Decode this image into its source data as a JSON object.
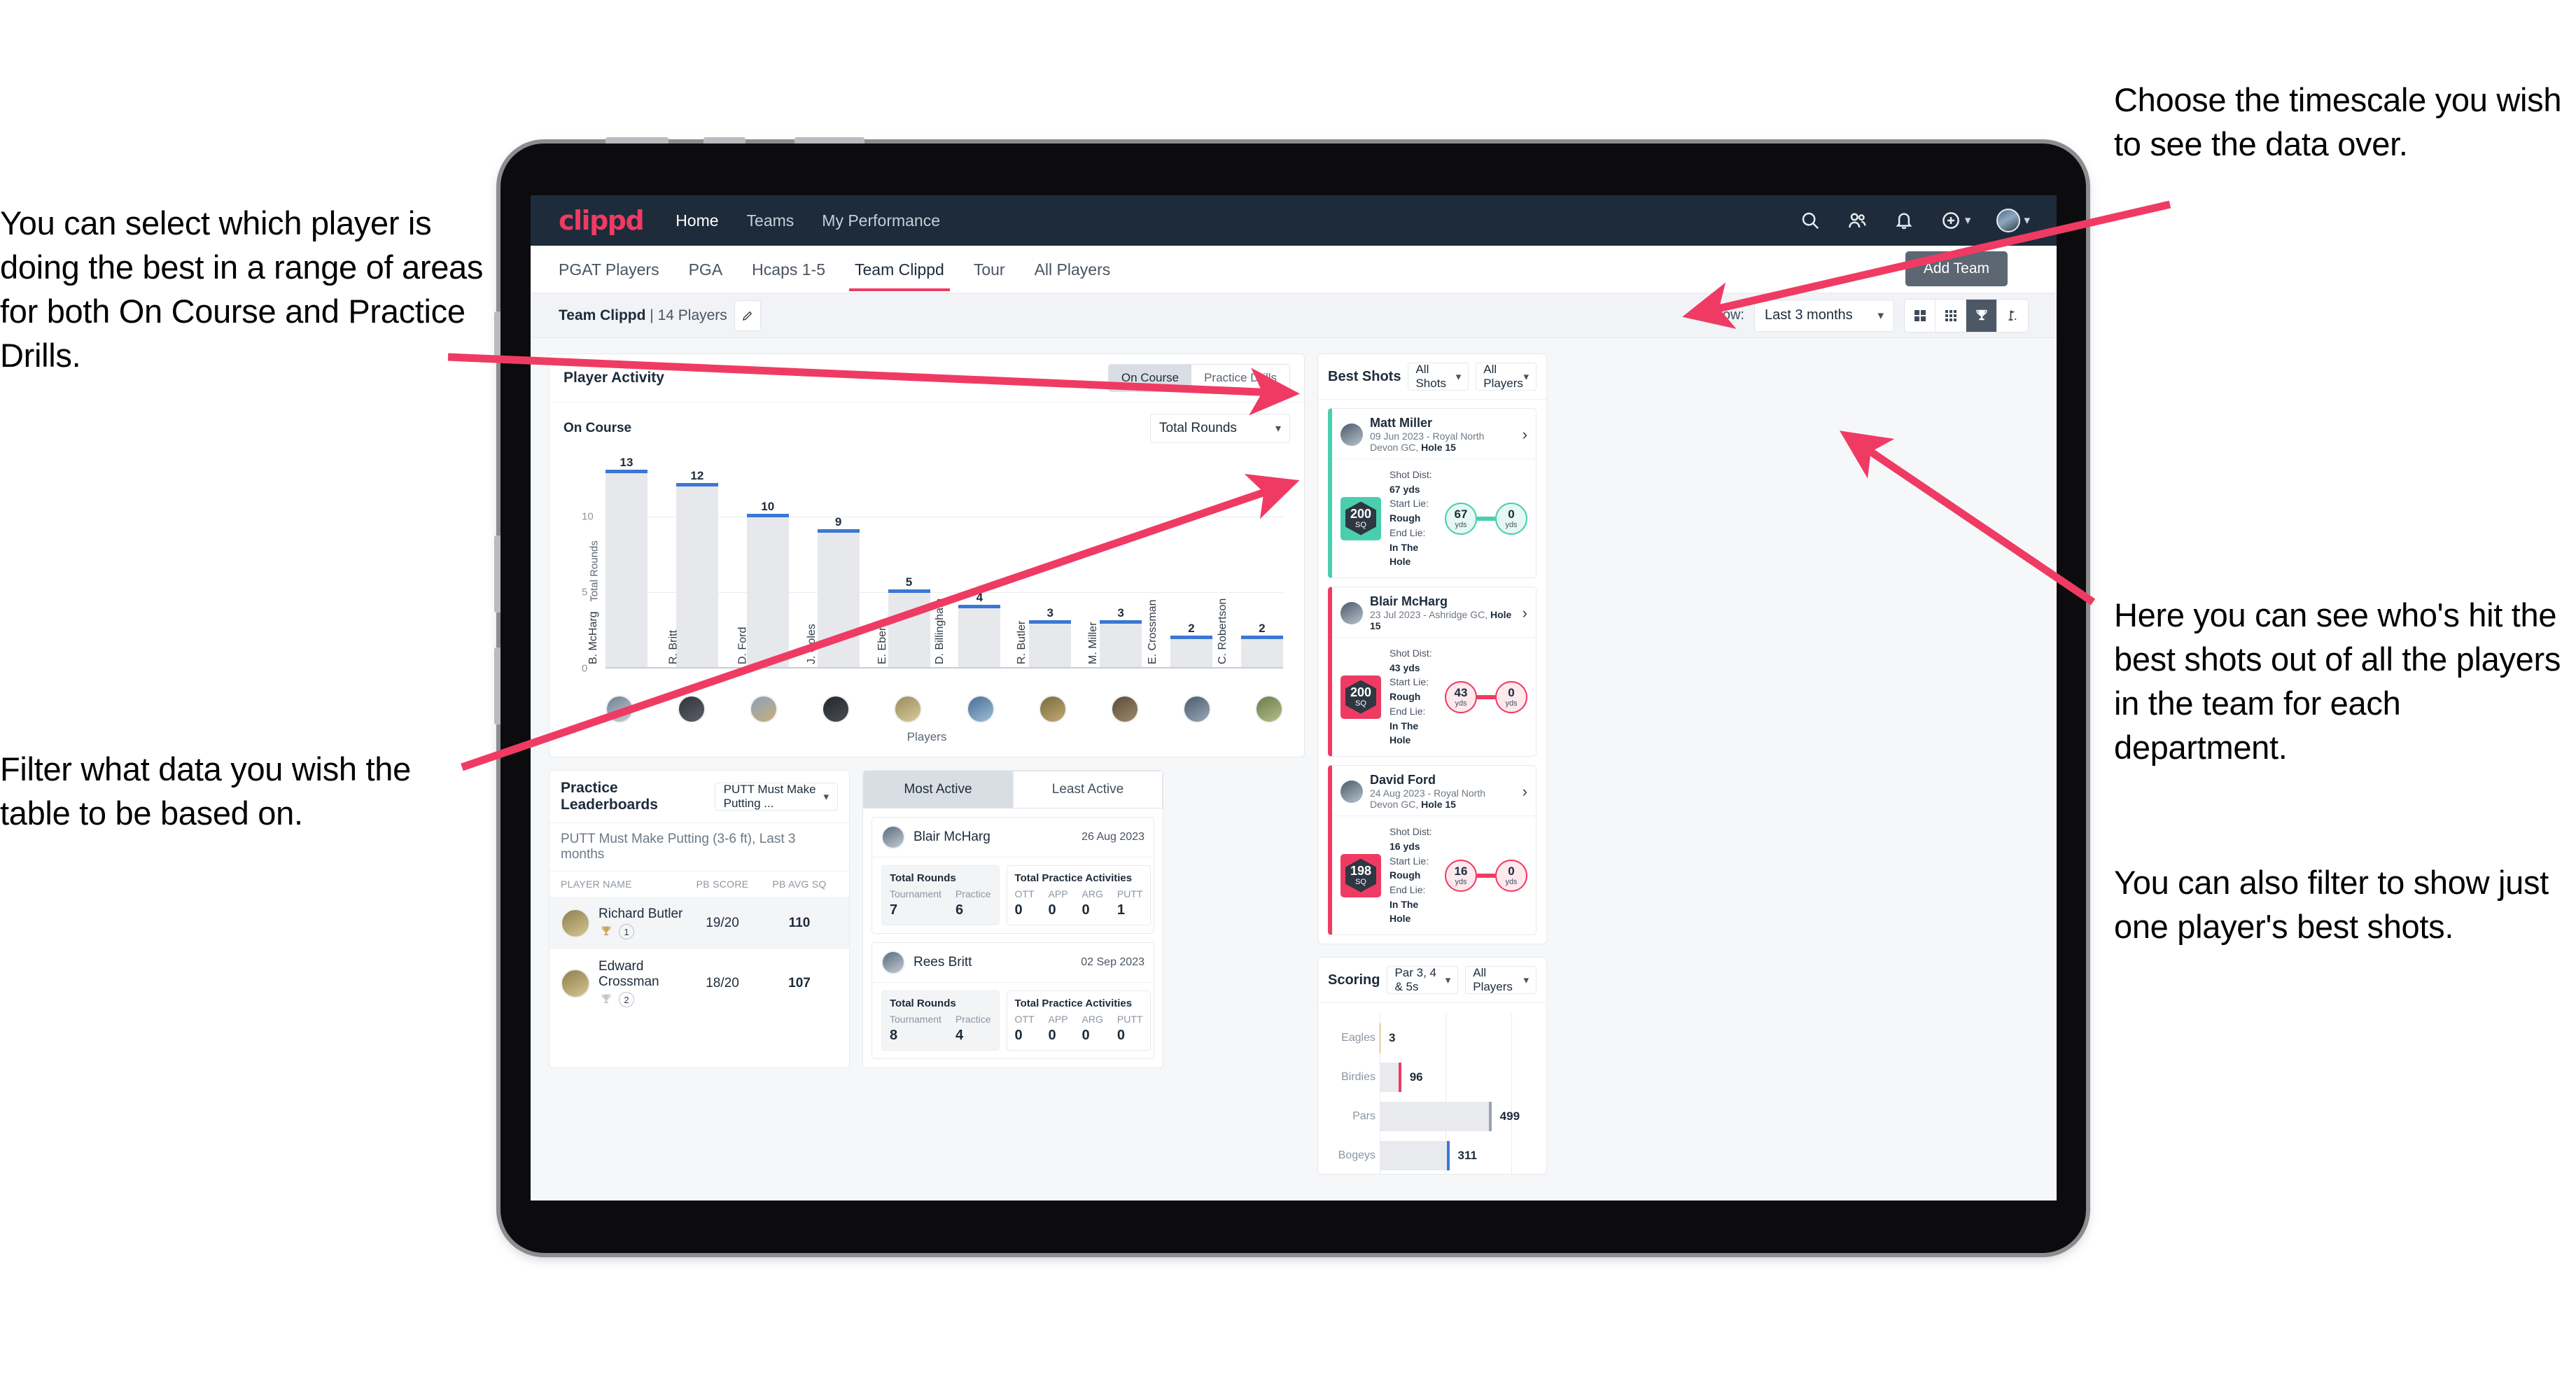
{
  "annotations": {
    "left_top": "You can select which player is doing the best in a range of areas for both On Course and Practice Drills.",
    "left_bottom": "Filter what data you wish the table to be based on.",
    "right_top": "Choose the timescale you wish to see the data over.",
    "right_mid": "Here you can see who's hit the best shots out of all the players in the team for each department.",
    "right_bottom": "You can also filter to show just one player's best shots."
  },
  "app": {
    "logo": "clippd",
    "nav": [
      {
        "label": "Home",
        "active": true
      },
      {
        "label": "Teams",
        "active": false
      },
      {
        "label": "My Performance",
        "active": false
      }
    ],
    "icons": [
      "search-icon",
      "people-icon",
      "bell-icon",
      "plus-circle-icon",
      "avatar"
    ],
    "tabs": [
      {
        "label": "PGAT Players",
        "active": false
      },
      {
        "label": "PGA",
        "active": false
      },
      {
        "label": "Hcaps 1-5",
        "active": false
      },
      {
        "label": "Team Clippd",
        "active": true
      },
      {
        "label": "Tour",
        "active": false
      },
      {
        "label": "All Players",
        "active": false
      }
    ],
    "add_team": "Add Team",
    "toolbar": {
      "team_name": "Team Clippd",
      "team_count": "| 14 Players",
      "show_label": "Show:",
      "timescale": "Last 3 months",
      "views": [
        {
          "name": "grid-4-icon",
          "active": false
        },
        {
          "name": "grid-9-icon",
          "active": false
        },
        {
          "name": "trophy-icon",
          "active": true
        },
        {
          "name": "golf-flag-icon",
          "active": false
        }
      ]
    }
  },
  "player_activity": {
    "title": "Player Activity",
    "segments": [
      {
        "label": "On Course",
        "active": true
      },
      {
        "label": "Practice Drills",
        "active": false
      }
    ],
    "sub_label": "On Course",
    "metric_select": "Total Rounds"
  },
  "chart_data": [
    {
      "type": "bar",
      "title": "Player Activity",
      "categories": [
        "B. McHarg",
        "R. Britt",
        "D. Ford",
        "J. Coles",
        "E. Ebert",
        "D. Billingham",
        "R. Butler",
        "M. Miller",
        "E. Crossman",
        "C. Robertson"
      ],
      "values": [
        13,
        12,
        10,
        9,
        5,
        4,
        3,
        3,
        2,
        2
      ],
      "xlabel": "Players",
      "ylabel": "Total Rounds",
      "ylim": [
        0,
        14
      ],
      "yticks": [
        0,
        5,
        10
      ],
      "grid": true,
      "legend": "none",
      "bar_color": "#e6e8ec",
      "cap_color": "#3b77d4"
    },
    {
      "type": "bar",
      "orientation": "horizontal",
      "title": "Scoring",
      "categories": [
        "Eagles",
        "Birdies",
        "Pars",
        "Bogeys"
      ],
      "values": [
        3,
        96,
        499,
        311
      ],
      "xlabel": "",
      "ylabel": "",
      "xlim": [
        0,
        700
      ],
      "grid": true,
      "legend": "none",
      "cap_colors": [
        "#c8a04a",
        "#ef3b63",
        "#9aa2ab",
        "#3b77d4"
      ]
    }
  ],
  "best_shots": {
    "title": "Best Shots",
    "filter_shots": "All Shots",
    "filter_players": "All Players",
    "items": [
      {
        "name": "Matt Miller",
        "meta_date": "09 Jun 2023 - Royal North Devon GC,",
        "meta_hole": "Hole 15",
        "score": "200",
        "score_unit": "SQ",
        "shot_dist_label": "Shot Dist:",
        "shot_dist": "67 yds",
        "start_lie_label": "Start Lie:",
        "start_lie": "Rough",
        "end_lie_label": "End Lie:",
        "end_lie": "In The Hole",
        "from_value": "67",
        "from_unit": "yds",
        "to_value": "0",
        "to_unit": "yds",
        "accent": "#49cfae"
      },
      {
        "name": "Blair McHarg",
        "meta_date": "23 Jul 2023 - Ashridge GC,",
        "meta_hole": "Hole 15",
        "score": "200",
        "score_unit": "SQ",
        "shot_dist_label": "Shot Dist:",
        "shot_dist": "43 yds",
        "start_lie_label": "Start Lie:",
        "start_lie": "Rough",
        "end_lie_label": "End Lie:",
        "end_lie": "In The Hole",
        "from_value": "43",
        "from_unit": "yds",
        "to_value": "0",
        "to_unit": "yds",
        "accent": "#ef3b63"
      },
      {
        "name": "David Ford",
        "meta_date": "24 Aug 2023 - Royal North Devon GC,",
        "meta_hole": "Hole 15",
        "score": "198",
        "score_unit": "SQ",
        "shot_dist_label": "Shot Dist:",
        "shot_dist": "16 yds",
        "start_lie_label": "Start Lie:",
        "start_lie": "Rough",
        "end_lie_label": "End Lie:",
        "end_lie": "In The Hole",
        "from_value": "16",
        "from_unit": "yds",
        "to_value": "0",
        "to_unit": "yds",
        "accent": "#ef3b63"
      }
    ]
  },
  "practice_leaderboards": {
    "title": "Practice Leaderboards",
    "drill_select": "PUTT Must Make Putting ...",
    "subtitle": "PUTT Must Make Putting (3-6 ft),",
    "subtitle_period": "Last 3 months",
    "headers": [
      "PLAYER NAME",
      "PB SCORE",
      "PB AVG SQ"
    ],
    "rows": [
      {
        "name": "Richard Butler",
        "rank": "1",
        "trophy": "gold",
        "pb_score": "19/20",
        "pb_avg_sq": "110"
      },
      {
        "name": "Edward Crossman",
        "rank": "2",
        "trophy": "silver",
        "pb_score": "18/20",
        "pb_avg_sq": "107"
      }
    ]
  },
  "activity": {
    "tabs": [
      {
        "label": "Most Active",
        "active": true
      },
      {
        "label": "Least Active",
        "active": false
      }
    ],
    "cards": [
      {
        "name": "Blair McHarg",
        "date": "26 Aug 2023",
        "rounds_title": "Total Rounds",
        "rounds": [
          {
            "key": "Tournament",
            "value": "7"
          },
          {
            "key": "Practice",
            "value": "6"
          }
        ],
        "practice_title": "Total Practice Activities",
        "practice": [
          {
            "key": "OTT",
            "value": "0"
          },
          {
            "key": "APP",
            "value": "0"
          },
          {
            "key": "ARG",
            "value": "0"
          },
          {
            "key": "PUTT",
            "value": "1"
          }
        ]
      },
      {
        "name": "Rees Britt",
        "date": "02 Sep 2023",
        "rounds_title": "Total Rounds",
        "rounds": [
          {
            "key": "Tournament",
            "value": "8"
          },
          {
            "key": "Practice",
            "value": "4"
          }
        ],
        "practice_title": "Total Practice Activities",
        "practice": [
          {
            "key": "OTT",
            "value": "0"
          },
          {
            "key": "APP",
            "value": "0"
          },
          {
            "key": "ARG",
            "value": "0"
          },
          {
            "key": "PUTT",
            "value": "0"
          }
        ]
      }
    ]
  },
  "scoring": {
    "title": "Scoring",
    "filter_par": "Par 3, 4 & 5s",
    "filter_players": "All Players"
  },
  "colors": {
    "brand": "#ef3b63",
    "header_bg": "#1d2b3a",
    "accent_blue": "#3b77d4",
    "accent_teal": "#49cfae"
  }
}
